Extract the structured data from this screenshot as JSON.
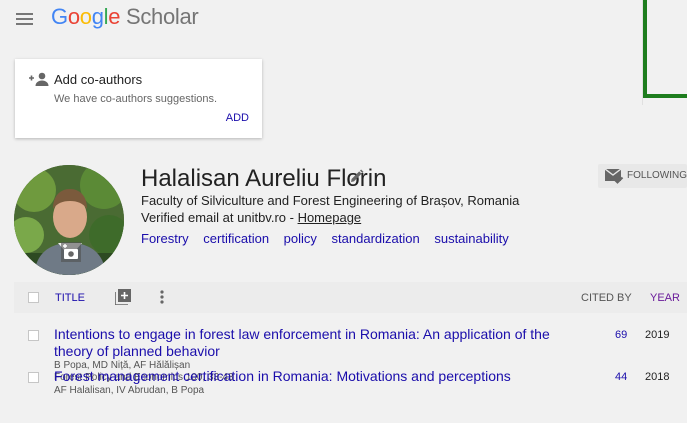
{
  "header": {
    "logo_parts": [
      "G",
      "o",
      "o",
      "g",
      "l",
      "e"
    ],
    "logo_suffix": " Scholar"
  },
  "coauthors": {
    "title": "Add co-authors",
    "subtitle": "We have co-authors suggestions.",
    "add_label": "ADD"
  },
  "profile": {
    "name": "Halalisan Aureliu Florin",
    "affiliation": "Faculty of Silviculture and Forest Engineering of Brașov, Romania",
    "email_prefix": "Verified email at unitbv.ro - ",
    "homepage_label": "Homepage",
    "interests": [
      "Forestry",
      "certification",
      "policy",
      "standardization",
      "sustainability"
    ],
    "follow_label": "FOLLOWING"
  },
  "table": {
    "title_label": "TITLE",
    "cited_label": "CITED BY",
    "year_label": "YEAR"
  },
  "articles": [
    {
      "title": "Intentions to engage in forest law enforcement in Romania: An application of the theory of planned behavior",
      "authors": "B Popa, MD Niță, AF Hălălișan",
      "source": "Forest Policy and Economics 100, 33-43",
      "cited": "69",
      "year": "2019"
    },
    {
      "title": "Forest management certification in Romania: Motivations and perceptions",
      "authors": "AF Halalisan, IV Abrudan, B Popa",
      "source": "",
      "cited": "44",
      "year": "2018"
    }
  ],
  "colors": {
    "link": "#1a0dab",
    "year_header": "#6a1b9a",
    "frame_green": "#1e7d1e"
  },
  "icons": [
    "menu-icon",
    "add-person-icon",
    "pencil-icon",
    "camera-icon",
    "email-follow-icon",
    "add-column-icon",
    "more-vert-icon"
  ]
}
